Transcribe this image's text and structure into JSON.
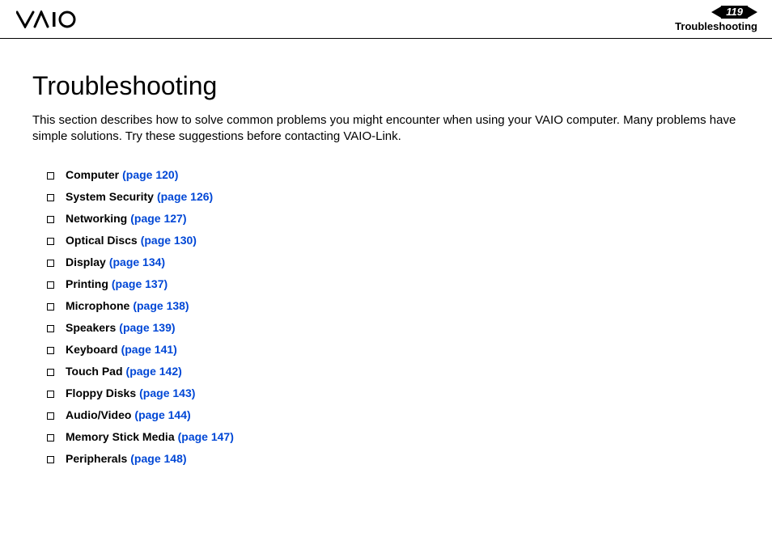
{
  "header": {
    "page_number": "119",
    "section": "Troubleshooting"
  },
  "title": "Troubleshooting",
  "intro": "This section describes how to solve common problems you might encounter when using your VAIO computer. Many problems have simple solutions. Try these suggestions before contacting VAIO-Link.",
  "topics": [
    {
      "label": "Computer",
      "page_ref": "(page 120)"
    },
    {
      "label": "System Security",
      "page_ref": "(page 126)"
    },
    {
      "label": "Networking",
      "page_ref": "(page 127)"
    },
    {
      "label": "Optical Discs",
      "page_ref": "(page 130)"
    },
    {
      "label": "Display",
      "page_ref": "(page 134)"
    },
    {
      "label": "Printing",
      "page_ref": "(page 137)"
    },
    {
      "label": "Microphone",
      "page_ref": "(page 138)"
    },
    {
      "label": "Speakers",
      "page_ref": "(page 139)"
    },
    {
      "label": "Keyboard",
      "page_ref": "(page 141)"
    },
    {
      "label": "Touch Pad",
      "page_ref": "(page 142)"
    },
    {
      "label": "Floppy Disks",
      "page_ref": "(page 143)"
    },
    {
      "label": "Audio/Video",
      "page_ref": "(page 144)"
    },
    {
      "label": "Memory Stick Media",
      "page_ref": "(page 147)"
    },
    {
      "label": "Peripherals",
      "page_ref": "(page 148)"
    }
  ]
}
